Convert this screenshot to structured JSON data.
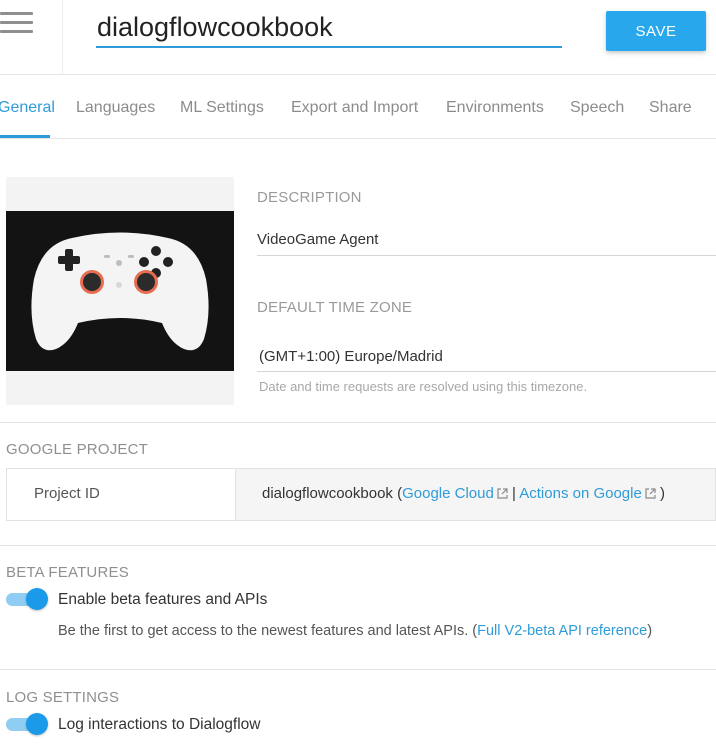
{
  "header": {
    "agent_name": "dialogflowcookbook",
    "save_label": "SAVE"
  },
  "tabs": [
    {
      "label": "General",
      "active": true
    },
    {
      "label": "Languages",
      "active": false
    },
    {
      "label": "ML Settings",
      "active": false
    },
    {
      "label": "Export and Import",
      "active": false
    },
    {
      "label": "Environments",
      "active": false
    },
    {
      "label": "Speech",
      "active": false
    },
    {
      "label": "Share",
      "active": false
    }
  ],
  "agent": {
    "avatar_icon": "game-controller",
    "description_label": "DESCRIPTION",
    "description_value": "VideoGame Agent",
    "timezone_label": "DEFAULT TIME ZONE",
    "timezone_value": "(GMT+1:00) Europe/Madrid",
    "timezone_hint": "Date and time requests are resolved using this timezone."
  },
  "google_project": {
    "title": "GOOGLE PROJECT",
    "key": "Project ID",
    "value": "dialogflowcookbook",
    "open_paren": "(",
    "cloud_link": "Google Cloud",
    "divider": "|",
    "actions_link": "Actions on Google",
    "close_paren": ")"
  },
  "beta": {
    "title": "BETA FEATURES",
    "toggle_label": "Enable beta features and APIs",
    "toggle_on": true,
    "desc_text": "Be the first to get access to the newest features and latest APIs. (",
    "desc_link": "Full V2-beta API reference",
    "desc_close": ")"
  },
  "log": {
    "title": "LOG SETTINGS",
    "toggle_label": "Log interactions to Dialogflow",
    "toggle_on": true
  },
  "colors": {
    "accent": "#2f9bd8",
    "save_button": "#29a7ec",
    "toggle_thumb": "#1a9ae8",
    "toggle_track": "#8fcdf2"
  }
}
